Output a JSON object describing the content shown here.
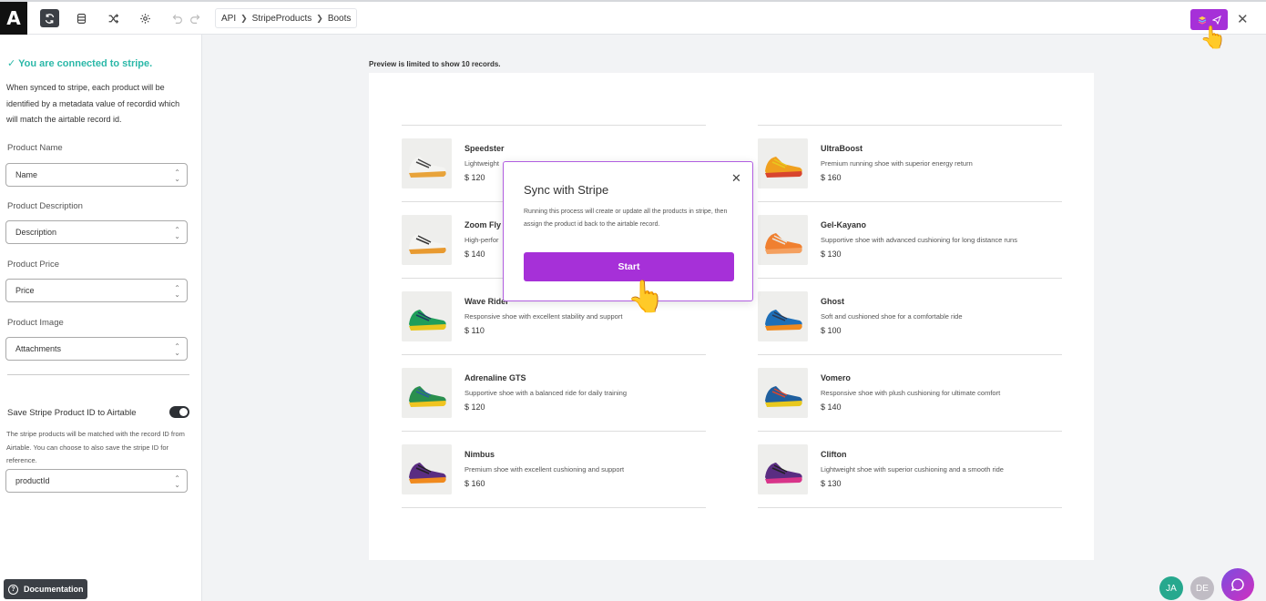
{
  "logo": "A",
  "breadcrumb": [
    "API",
    "StripeProducts",
    "Boots"
  ],
  "sidebar": {
    "connected": "You are connected to stripe.",
    "description": "When synced to stripe, each product will be identified by a metadata value of recordid which will match the airtable record id.",
    "fields": [
      {
        "label": "Product Name",
        "value": "Name"
      },
      {
        "label": "Product Description",
        "value": "Description"
      },
      {
        "label": "Product Price",
        "value": "Price"
      },
      {
        "label": "Product Image",
        "value": "Attachments"
      }
    ],
    "save_label": "Save Stripe Product ID to Airtable",
    "save_enabled": true,
    "save_desc": "The stripe products will be matched with the record ID from Airtable. You can choose to also save the stripe ID for reference.",
    "save_field_value": "productId",
    "documentation": "Documentation"
  },
  "preview_note": "Preview is limited to show 10 records.",
  "products_left": [
    {
      "name": "Speedster",
      "desc": "Lightweight",
      "price": "$ 120",
      "colors": [
        "#f4f4f2",
        "#e8a33a",
        "#444"
      ]
    },
    {
      "name": "Zoom Fly",
      "desc": "High-perfor",
      "price": "$ 140",
      "colors": [
        "#f4f4f2",
        "#e89a30",
        "#333"
      ]
    },
    {
      "name": "Wave Rider",
      "desc": "Responsive shoe with excellent stability and support",
      "price": "$ 110",
      "colors": [
        "#1f9e5a",
        "#e8c61e",
        "#1d3c63"
      ]
    },
    {
      "name": "Adrenaline GTS",
      "desc": "Supportive shoe with a balanced ride for daily training",
      "price": "$ 120",
      "colors": [
        "#2a8f4e",
        "#f0c420",
        "#2a5f9a"
      ]
    },
    {
      "name": "Nimbus",
      "desc": "Premium shoe with excellent cushioning and support",
      "price": "$ 160",
      "colors": [
        "#5a2d82",
        "#f08a1e",
        "#222"
      ]
    }
  ],
  "products_right": [
    {
      "name": "UltraBoost",
      "desc": "Premium running shoe with superior energy return",
      "price": "$ 160",
      "colors": [
        "#f0a01e",
        "#d8452e",
        "#e8c81e"
      ]
    },
    {
      "name": "Gel-Kayano",
      "desc": "Supportive shoe with advanced cushioning for long distance runs",
      "price": "$ 130",
      "colors": [
        "#f08030",
        "#f4a060",
        "#e8e4dc"
      ]
    },
    {
      "name": "Ghost",
      "desc": "Soft and cushioned shoe for a comfortable ride",
      "price": "$ 100",
      "colors": [
        "#1e6fb8",
        "#f08a1e",
        "#2a3a55"
      ]
    },
    {
      "name": "Vomero",
      "desc": "Responsive shoe with plush cushioning for ultimate comfort",
      "price": "$ 140",
      "colors": [
        "#1f5f9e",
        "#e8c81e",
        "#d8452e"
      ]
    },
    {
      "name": "Clifton",
      "desc": "Lightweight shoe with superior cushioning and a smooth ride",
      "price": "$ 130",
      "colors": [
        "#5a2d82",
        "#d8348a",
        "#222"
      ]
    }
  ],
  "modal": {
    "title": "Sync with Stripe",
    "desc": "Running this process will create or update all the products in stripe, then assign the product id back to the airtable record.",
    "start": "Start"
  },
  "avatars": [
    {
      "initials": "JA",
      "color": "#27a88e"
    },
    {
      "initials": "DE",
      "color": "#c0bcc4"
    }
  ],
  "colors": {
    "accent": "#a630d8",
    "success": "#2bb8a8"
  }
}
